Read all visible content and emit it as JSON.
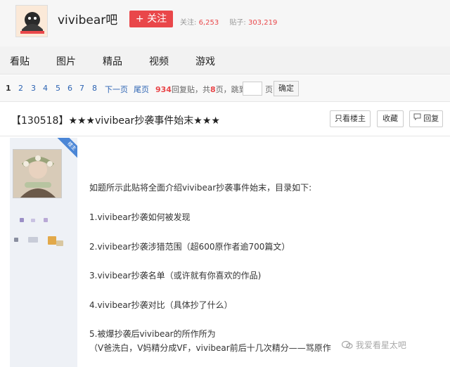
{
  "header": {
    "forum_name": "vivibear吧",
    "follow_label": "+ 关注",
    "followers_label": "关注:",
    "followers_count": "6,253",
    "posts_label": "贴子:",
    "posts_count": "303,219"
  },
  "nav": {
    "items": [
      "看贴",
      "图片",
      "精品",
      "视频",
      "游戏"
    ]
  },
  "pager": {
    "pages": [
      "1",
      "2",
      "3",
      "4",
      "5",
      "6",
      "7",
      "8"
    ],
    "next": "下一页",
    "last": "尾页",
    "reply_count": "934",
    "reply_text": "回复贴，共",
    "total_pages": "8",
    "page_unit": "页，",
    "jump_label": "跳到",
    "jump_unit": "页",
    "confirm": "确定"
  },
  "thread": {
    "title": "【130518】★★★vivibear抄袭事件始末★★★",
    "only_op": "只看楼主",
    "favorite": "收藏",
    "reply": "回复"
  },
  "post": {
    "badge": "楼主",
    "lines": [
      "如题所示此贴将全面介绍vivibear抄袭事件始末，目录如下:",
      "1.vivibear抄袭如何被发现",
      "2.vivibear抄袭涉猎范围（超600原作者逾700篇文）",
      "3.vivibear抄袭名单（或许就有你喜欢的作品)",
      "4.vivibear抄袭对比（具体抄了什么）",
      "5.被爆抄袭后vivibear的所作所为",
      "（V爸洗白，V妈精分成VF，vivibear前后十几次精分——骂原作"
    ],
    "watermark": "我爱看星太吧"
  }
}
